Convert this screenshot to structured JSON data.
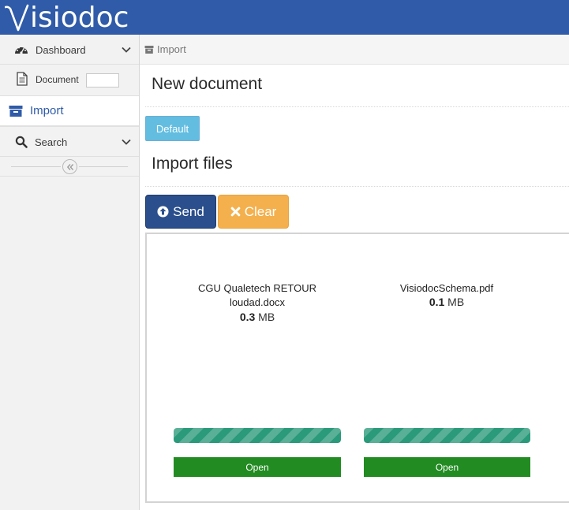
{
  "app": {
    "logo_text": "isiodoc",
    "brand_color": "#2f5ba8"
  },
  "sidebar": {
    "items": [
      {
        "label": "Dashboard",
        "icon": "dashboard-icon",
        "has_chevron": true
      },
      {
        "label": "Document",
        "icon": "document-icon",
        "has_chevron": false
      },
      {
        "label": "Import",
        "icon": "archive-icon",
        "active": true
      },
      {
        "label": "Search",
        "icon": "search-icon",
        "has_chevron": true
      }
    ],
    "collapse_icon": "double-chevron-left-icon"
  },
  "breadcrumb": {
    "icon": "archive-icon",
    "label": "Import"
  },
  "main": {
    "new_document_title": "New document",
    "default_button": "Default",
    "import_files_title": "Import files",
    "send_button": "Send",
    "clear_button": "Clear"
  },
  "files": [
    {
      "name": "CGU Qualetech RETOUR loudad.docx",
      "size_value": "0.3",
      "size_unit": "MB",
      "progress": 1.0,
      "open_label": "Open"
    },
    {
      "name": "VisiodocSchema.pdf",
      "size_value": "0.1",
      "size_unit": "MB",
      "progress": 1.0,
      "open_label": "Open"
    }
  ],
  "colors": {
    "default_button": "#62bde0",
    "send_button": "#2b4f8c",
    "clear_button": "#f4b04d",
    "progress": "#2a9a7a",
    "open_button": "#228b22"
  }
}
